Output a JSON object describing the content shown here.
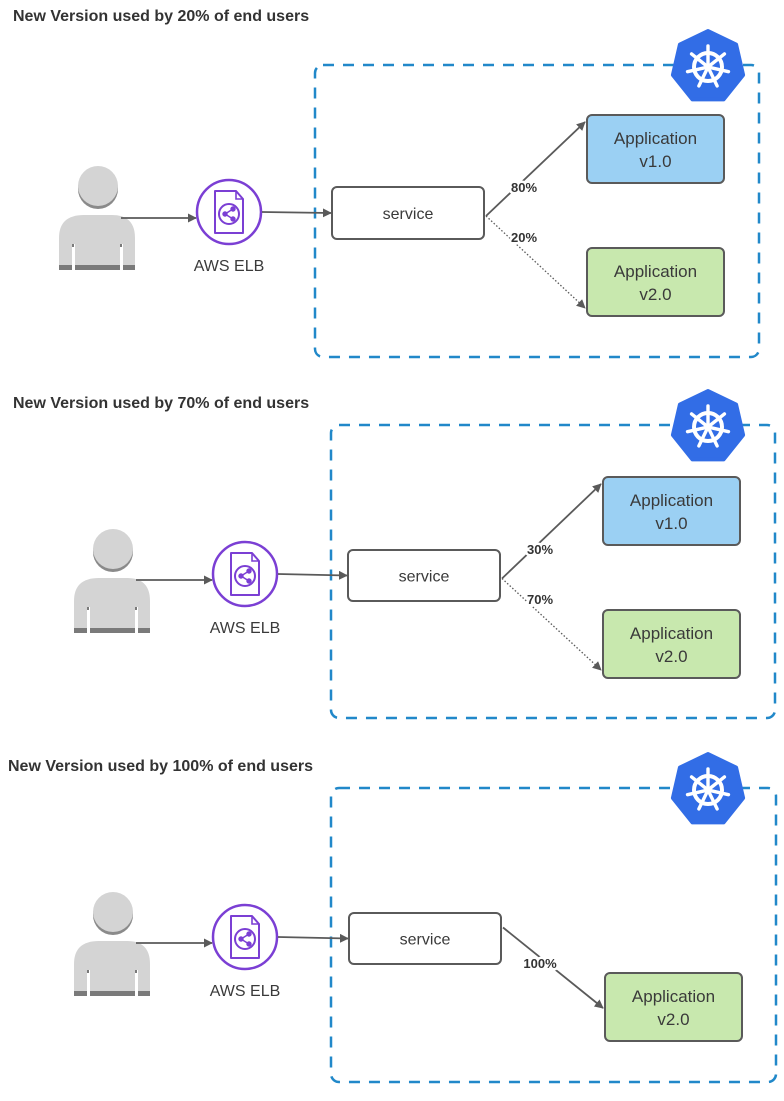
{
  "colors": {
    "cluster_border": "#2188C9",
    "kubernetes_blue": "#326DE6",
    "elb_purple": "#7B3FD4",
    "user_gray": "#D4D4D4",
    "user_dark": "#7A7A7A",
    "edge": "#5A5A5A",
    "app_v1_fill": "#9BD0F3",
    "app_v2_fill": "#C8E8AE",
    "box_border": "#5A5A5A"
  },
  "panels": [
    {
      "title": "New Version used by 20% of end users",
      "elb_label": "AWS ELB",
      "service_label": "service",
      "apps": [
        {
          "line1": "Application",
          "line2": "v1.0",
          "version": "v1",
          "traffic": "80%",
          "style": "solid"
        },
        {
          "line1": "Application",
          "line2": "v2.0",
          "version": "v2",
          "traffic": "20%",
          "style": "dotted"
        }
      ]
    },
    {
      "title": "New Version used by 70% of end users",
      "elb_label": "AWS ELB",
      "service_label": "service",
      "apps": [
        {
          "line1": "Application",
          "line2": "v1.0",
          "version": "v1",
          "traffic": "30%",
          "style": "solid"
        },
        {
          "line1": "Application",
          "line2": "v2.0",
          "version": "v2",
          "traffic": "70%",
          "style": "dotted"
        }
      ]
    },
    {
      "title": "New Version used by 100% of end users",
      "elb_label": "AWS ELB",
      "service_label": "service",
      "apps": [
        {
          "line1": "Application",
          "line2": "v2.0",
          "version": "v2",
          "traffic": "100%",
          "style": "solid"
        }
      ]
    }
  ]
}
